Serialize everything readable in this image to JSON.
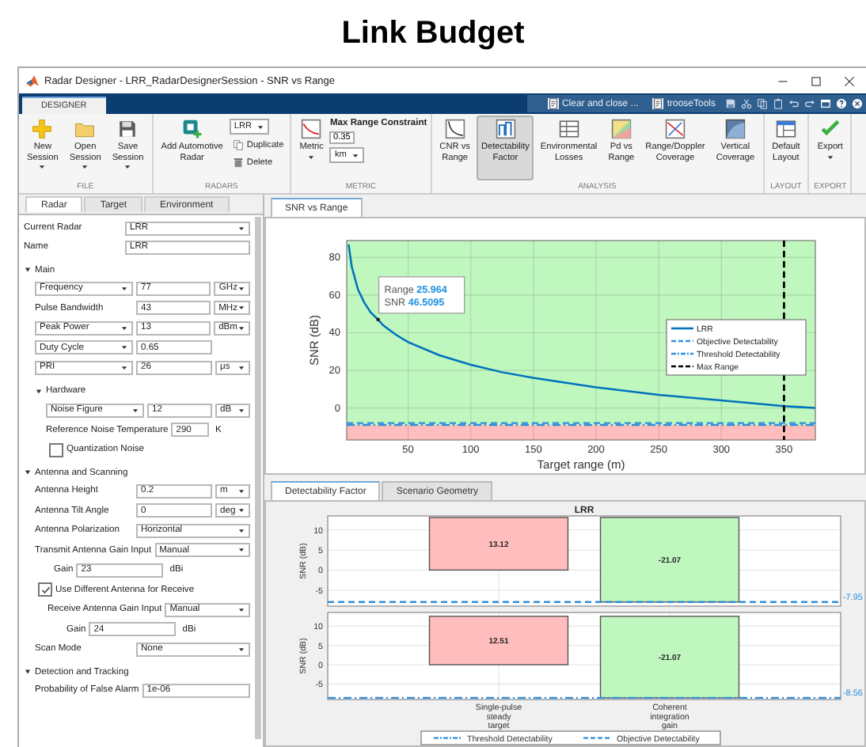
{
  "heading": "Link Budget",
  "window": {
    "title": "Radar Designer - LRR_RadarDesignerSession - SNR vs Range"
  },
  "ribbon_tabs": [
    {
      "label": "DESIGNER",
      "selected": true
    }
  ],
  "quick_access": [
    "Clear and close ...",
    "trooseTools"
  ],
  "toolstrip": [
    {
      "label": "FILE",
      "items": [
        {
          "kind": "large",
          "label": "New\nSession",
          "menu": true
        },
        {
          "kind": "large",
          "label": "Open\nSession",
          "menu": true
        },
        {
          "kind": "large",
          "label": "Save\nSession",
          "menu": true
        }
      ]
    },
    {
      "label": "RADARS",
      "items": [
        {
          "kind": "large",
          "label": "Add Automotive\nRadar",
          "menu": false
        },
        {
          "kind": "stack",
          "items": [
            {
              "kind": "dropdown",
              "value": "LRR"
            },
            {
              "kind": "small",
              "label": "Duplicate"
            },
            {
              "kind": "small",
              "label": "Delete"
            }
          ]
        }
      ]
    },
    {
      "label": "METRIC",
      "items": [
        {
          "kind": "large",
          "label": "Metric",
          "menu": true
        },
        {
          "kind": "stack",
          "items": [
            {
              "kind": "heading",
              "label": "Max Range Constraint"
            },
            {
              "kind": "field",
              "value": "0.35"
            },
            {
              "kind": "dropdown",
              "value": "km"
            }
          ]
        }
      ]
    },
    {
      "label": "ANALYSIS",
      "items": [
        {
          "kind": "large",
          "label": "CNR vs\nRange",
          "menu": false,
          "selected": false
        },
        {
          "kind": "large",
          "label": "Detectability\nFactor",
          "menu": false,
          "selected": true
        },
        {
          "kind": "large",
          "label": "Environmental\nLosses",
          "menu": false,
          "selected": false
        },
        {
          "kind": "large",
          "label": "Pd vs\nRange",
          "menu": false,
          "selected": false
        },
        {
          "kind": "large",
          "label": "Range/Doppler\nCoverage",
          "menu": false,
          "selected": false
        },
        {
          "kind": "large",
          "label": "Vertical\nCoverage",
          "menu": false,
          "selected": false
        }
      ]
    },
    {
      "label": "LAYOUT",
      "items": [
        {
          "kind": "large",
          "label": "Default\nLayout",
          "menu": false
        }
      ]
    },
    {
      "label": "EXPORT",
      "items": [
        {
          "kind": "large",
          "label": "Export",
          "menu": true
        }
      ]
    }
  ],
  "settings_panel": {
    "tabs": [
      {
        "label": "Radar",
        "selected": true
      },
      {
        "label": "Target",
        "selected": false
      },
      {
        "label": "Environment",
        "selected": false
      }
    ],
    "rows": [
      {
        "kind": "select",
        "label": "Current Radar",
        "value": "LRR"
      },
      {
        "kind": "text",
        "label": "Name",
        "value": "LRR"
      },
      {
        "kind": "section",
        "title": "Main",
        "expanded": true,
        "children": [
          {
            "kind": "param",
            "label": "Frequency",
            "label_menu": true,
            "value": "77",
            "unit": "GHz",
            "unit_menu": true
          },
          {
            "kind": "param",
            "label": "Pulse Bandwidth",
            "label_menu": false,
            "value": "43",
            "unit": "MHz",
            "unit_menu": true
          },
          {
            "kind": "param",
            "label": "Peak Power",
            "label_menu": true,
            "value": "13",
            "unit": "dBm",
            "unit_menu": true
          },
          {
            "kind": "param",
            "label": "Duty Cycle",
            "label_menu": true,
            "value": "0.65"
          },
          {
            "kind": "param",
            "label": "PRI",
            "label_menu": true,
            "value": "26",
            "unit": "μs",
            "unit_menu": true
          },
          {
            "kind": "section",
            "title": "Hardware",
            "expanded": true,
            "children": [
              {
                "kind": "param",
                "label": "Noise Figure",
                "label_menu": true,
                "value": "12",
                "unit": "dB",
                "unit_menu": true
              },
              {
                "kind": "param",
                "label": "Reference Noise Temperature",
                "label_menu": false,
                "value": "290",
                "unit": "K",
                "unit_menu": false
              },
              {
                "kind": "checkbox",
                "label": "Quantization Noise",
                "checked": false
              }
            ]
          }
        ]
      },
      {
        "kind": "section",
        "title": "Antenna and Scanning",
        "expanded": true,
        "children": [
          {
            "kind": "param",
            "label": "Antenna Height",
            "label_menu": false,
            "value": "0.2",
            "unit": "m",
            "unit_menu": true
          },
          {
            "kind": "param",
            "label": "Antenna Tilt Angle",
            "label_menu": false,
            "value": "0",
            "unit": "deg",
            "unit_menu": true
          },
          {
            "kind": "select",
            "label": "Antenna Polarization",
            "value": "Horizontal"
          },
          {
            "kind": "select",
            "label": "Transmit Antenna Gain Input",
            "value": "Manual",
            "children": [
              {
                "kind": "short-param",
                "label": "Gain",
                "value": "23",
                "unit": "dBi"
              }
            ]
          },
          {
            "kind": "checkbox",
            "label": "Use Different Antenna for Receive",
            "checked": true,
            "children": [
              {
                "kind": "select",
                "label": "Receive Antenna Gain Input",
                "value": "Manual",
                "children": [
                  {
                    "kind": "short-param",
                    "label": "Gain",
                    "value": "24",
                    "unit": "dBi"
                  }
                ]
              }
            ]
          },
          {
            "kind": "select",
            "label": "Scan Mode",
            "value": "None"
          }
        ]
      },
      {
        "kind": "section",
        "title": "Detection and Tracking",
        "expanded": true,
        "children": [
          {
            "kind": "text",
            "label": "Probability of False Alarm",
            "value": "1e-06"
          }
        ]
      }
    ]
  },
  "snr_view": {
    "tab": {
      "label": "SNR vs Range",
      "selected": true
    },
    "chart_data": {
      "type": "line",
      "xlabel": "Target range (m)",
      "ylabel": "SNR (dB)",
      "x": [
        2.5,
        5,
        10,
        15,
        20,
        26,
        30,
        40,
        50,
        75,
        100,
        125,
        150,
        200,
        250,
        300,
        350,
        375
      ],
      "series": [
        {
          "name": "LRR",
          "color": "#0072bd",
          "line_style": "solid",
          "values": [
            87,
            75,
            63,
            56,
            51,
            47,
            44,
            39,
            35,
            28,
            23,
            19,
            16,
            11,
            7,
            4,
            1,
            0
          ]
        }
      ],
      "ref_lines": [
        {
          "axis": "y",
          "value": -8,
          "label": "Objective Detectability",
          "color": "#2f8fdc",
          "line_style": "dashed"
        },
        {
          "axis": "y",
          "value": -9,
          "label": "Threshold Detectability",
          "color": "#2f8fdc",
          "line_style": "dashdot"
        },
        {
          "axis": "x",
          "value": 350,
          "label": "Max Range",
          "color": "#000000",
          "line_style": "dashed"
        }
      ],
      "bands": [
        {
          "axis": "y",
          "from": -17,
          "to": -9,
          "color": "#ffbdbd"
        }
      ],
      "xlim": [
        1,
        375
      ],
      "ylim": [
        -17,
        89
      ],
      "xticks": [
        50,
        100,
        150,
        200,
        250,
        300,
        350
      ],
      "yticks": [
        0,
        20,
        40,
        60,
        80
      ],
      "grid": true,
      "legend": "right",
      "annotations": [
        {
          "x": 26,
          "y": 47,
          "text": "Range **25.964**\nSNR **46.5095**"
        }
      ]
    }
  },
  "detectability_view": {
    "tabs": [
      {
        "label": "Detectability Factor",
        "selected": true
      },
      {
        "label": "Scenario Geometry",
        "selected": false
      }
    ],
    "title": "LRR",
    "panels": [
      {
        "ylabel": "SNR (dB)",
        "yticks": [
          "10",
          "5",
          "0",
          "-5"
        ],
        "bars": [
          {
            "label": "13.12"
          },
          {
            "label": "-21.07"
          }
        ],
        "line_label": "-7.95"
      },
      {
        "ylabel": "SNR (dB)",
        "yticks": [
          "10",
          "5",
          "0",
          "-5"
        ],
        "bars": [
          {
            "label": "12.51"
          },
          {
            "label": "-21.07"
          }
        ],
        "line_label": "-8.56"
      }
    ],
    "categories": [
      "Single-pulse steady target",
      "Coherent integration gain"
    ],
    "legend": [
      {
        "label": "Threshold Detectability"
      },
      {
        "label": "Objective Detectability"
      }
    ]
  }
}
